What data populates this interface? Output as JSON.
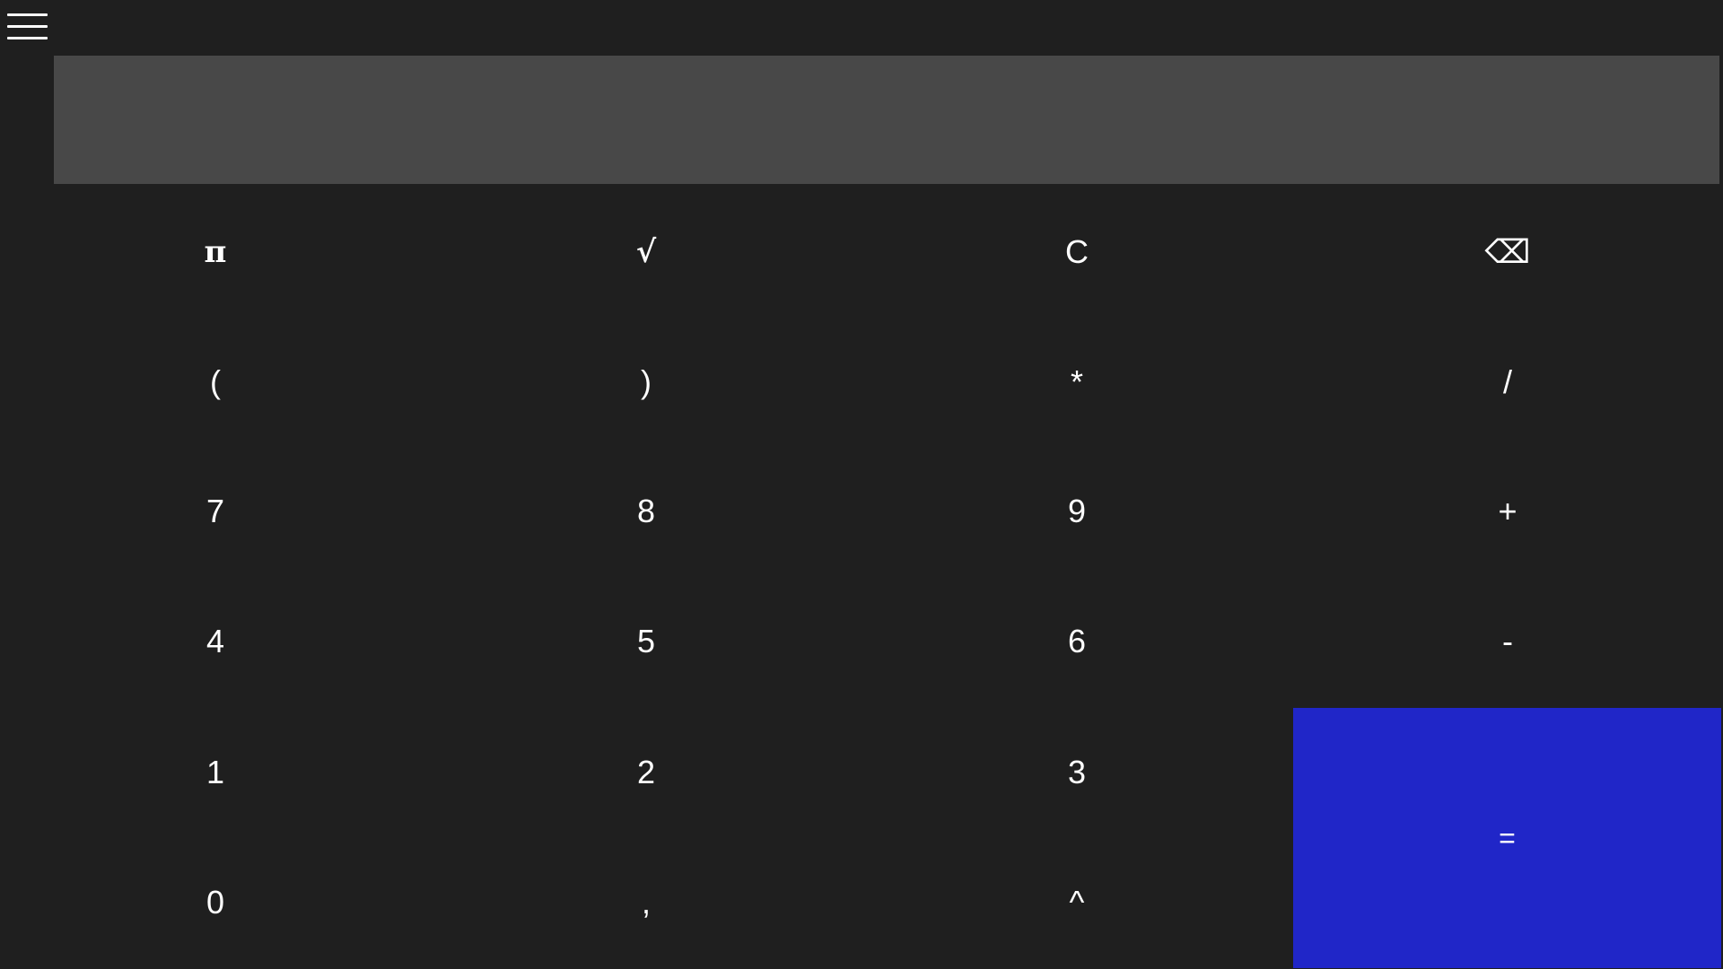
{
  "menu": {
    "icon": "hamburger-menu-icon"
  },
  "display": {
    "value": ""
  },
  "keys": {
    "pi": "π",
    "sqrt": "√",
    "clear": "C",
    "backspace": "⌫",
    "open_paren": "(",
    "close_paren": ")",
    "multiply": "*",
    "divide": "/",
    "seven": "7",
    "eight": "8",
    "nine": "9",
    "plus": "+",
    "four": "4",
    "five": "5",
    "six": "6",
    "minus": "-",
    "one": "1",
    "two": "2",
    "three": "3",
    "equals": "=",
    "zero": "0",
    "comma": ",",
    "power": "^"
  },
  "colors": {
    "background": "#1f1f1f",
    "display_background": "#484848",
    "equals_background": "#2026c8",
    "text": "#ffffff"
  }
}
